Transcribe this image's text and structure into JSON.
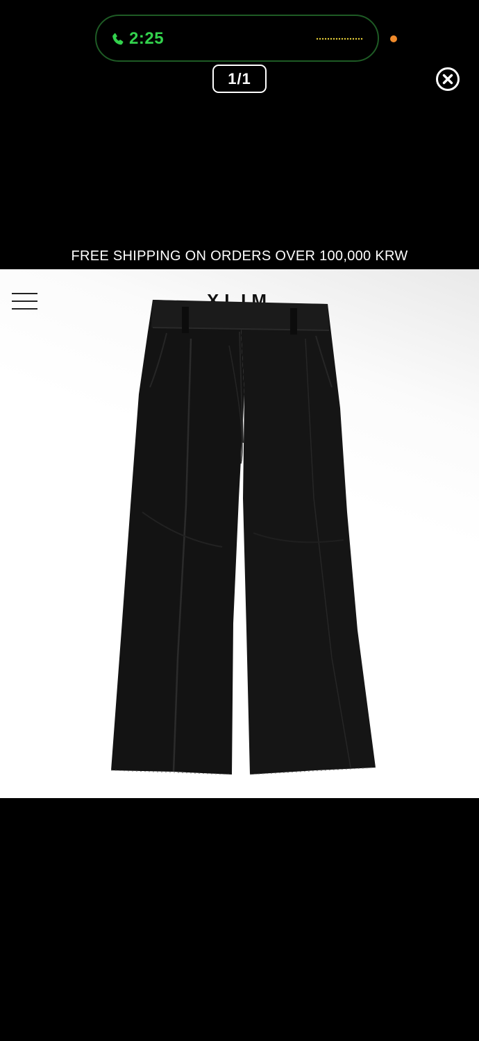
{
  "call_status": {
    "time": "2:25",
    "icon": "phone-icon",
    "activity_icon": "waveform-icon",
    "accent_color": "#33d24d",
    "privacy_indicator_color": "#f08a2b"
  },
  "viewer": {
    "counter": "1/1",
    "close_icon": "close-circle-icon"
  },
  "store": {
    "banner": "FREE SHIPPING ON ORDERS OVER 100,000 KRW",
    "brand": "XLIM",
    "menu_icon": "hamburger-menu-icon"
  },
  "product": {
    "image_subject": "black flared trousers",
    "color": "#121212"
  }
}
